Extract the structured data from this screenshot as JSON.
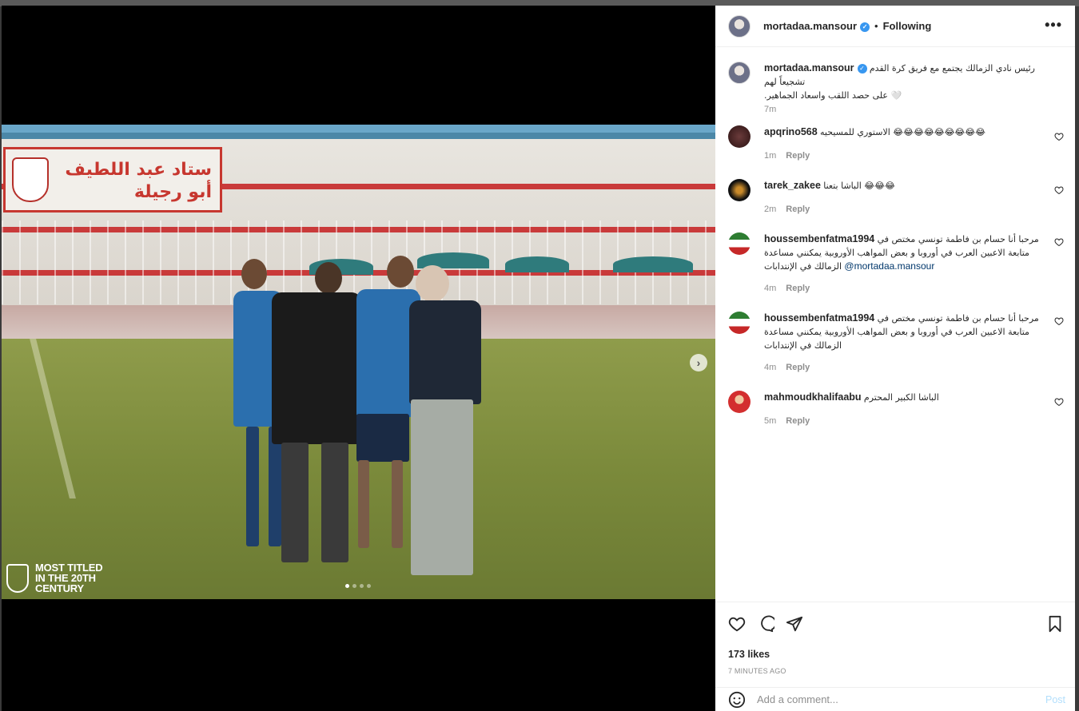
{
  "post": {
    "author": "mortadaa.mansour",
    "follow_status": "Following",
    "more_label": "•••",
    "caption_line1": "رئيس نادي الزمالك يجتمع مع فريق كرة القدم تشجيعاً لهم",
    "caption_line2": ".على حصد اللقب واسعاد الجماهير 🤍",
    "caption_time": "7m",
    "likes": "173 likes",
    "time_ago": "7 MINUTES AGO"
  },
  "media": {
    "sign_text": "ستاد عبد اللطيف أبو رجيلة",
    "watermark_line1": "MOST TITLED",
    "watermark_line2": "IN THE 20TH",
    "watermark_line3": "CENTURY",
    "next_label": "›"
  },
  "comments": [
    {
      "user": "apqrino568",
      "text": "الاستوري للمسيحيه 😂😂😂😂😂😂😂😂😂",
      "time": "1m",
      "reply": "Reply"
    },
    {
      "user": "tarek_zakee",
      "text": "الباشا بتعنا 😂😂😂",
      "time": "2m",
      "reply": "Reply"
    },
    {
      "user": "houssembenfatma1994",
      "text": "مرحبا أنا حسام بن فاطمة تونسي مختص في متابعة الاعبين العرب في أوروبا و بعض المواهب الأوروبية يمكنني مساعدة الزمالك في الإنتدابات",
      "mention": "@mortadaa.mansour",
      "time": "4m",
      "reply": "Reply"
    },
    {
      "user": "houssembenfatma1994",
      "text": "مرحبا أنا حسام بن فاطمة تونسي مختص في متابعة الاعبين العرب في أوروبا و بعض المواهب الأوروبية يمكنني مساعدة الزمالك في الإنتدابات",
      "time": "4m",
      "reply": "Reply"
    },
    {
      "user": "mahmoudkhalifaabu",
      "text": "الباشا الكبير المحترم",
      "time": "5m",
      "reply": "Reply"
    }
  ],
  "add_comment": {
    "placeholder": "Add a comment...",
    "post_label": "Post"
  },
  "colors": {
    "accent": "#3897f0",
    "post_disabled": "#b2dffc"
  }
}
